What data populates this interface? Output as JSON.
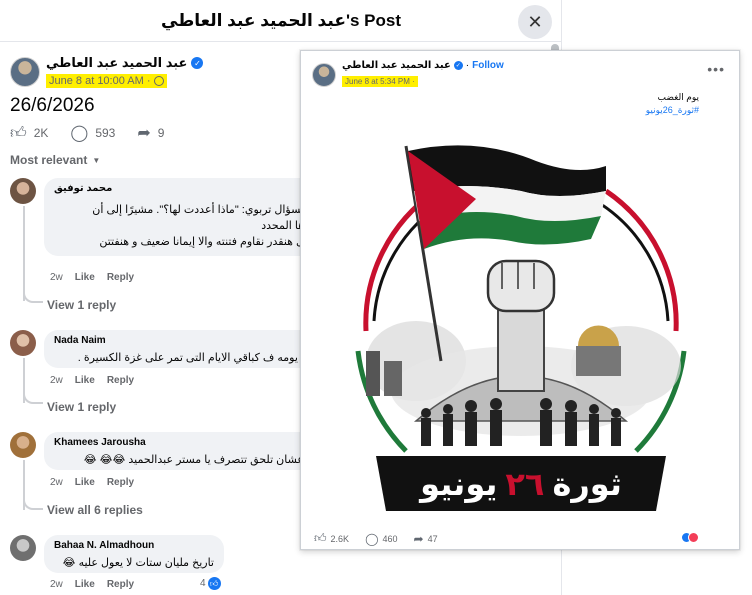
{
  "modal": {
    "title": "عبد الحميد عبد العاطي's Post",
    "close_icon": "close-icon"
  },
  "post": {
    "author": "عبد الحميد عبد العاطي",
    "time": "June 8 at 10:00 AM ·",
    "text": "26/6/2026",
    "likes": "2K",
    "comments": "593",
    "shares": "9"
  },
  "sort": {
    "label": "Most relevant"
  },
  "comments": [
    {
      "name": "محمد توفيق",
      "lines": [
        "بسؤال تربوي: \"ماذا أعددت لها؟\". مشيرًا إلى أن",
        "ها المحدد",
        "ل هنقدر نقاوم فتنته والا إيمانا ضعيف و هنفتتن"
      ],
      "age": "2w",
      "like": "Like",
      "reply": "Reply",
      "view_replies": "View 1 reply"
    },
    {
      "name": "Nada Naim",
      "lines": [
        "ا يومه ف كباقي الايام التى تمر على غزة الكسيرة ."
      ],
      "age": "2w",
      "like": "Like",
      "reply": "Reply",
      "view_replies": "View 1 reply"
    },
    {
      "name": "Khamees Jarousha",
      "lines": [
        "عشان تلحق تتصرف يا مستر عبدالحميد 😂😂 😂"
      ],
      "age": "2w",
      "like": "Like",
      "reply": "Reply",
      "view_replies": "View all 6 replies"
    },
    {
      "name": "Bahaa N. Almadhoun",
      "lines": [
        "تاريخ مليان ستات لا يعول عليه 😂"
      ],
      "age": "2w",
      "like": "Like",
      "reply": "Reply",
      "reactions": "4"
    }
  ],
  "card": {
    "author": "عبد الحميد عبد العاطي",
    "follow": "Follow",
    "time": "June 8 at 5:34 PM ·",
    "text_line1": "يوم الغضب",
    "hashtag": "#ثورة_26يونيو",
    "poster_title_a": "ثورة",
    "poster_title_num": "٢٦",
    "poster_title_b": "يونيو",
    "likes": "2.6K",
    "comments": "460",
    "shares": "47"
  },
  "colors": {
    "accent": "#1877f2",
    "highlight": "#ffef00",
    "flag_red": "#c8102e",
    "flag_green": "#1f7a3a",
    "flag_black": "#111111"
  }
}
